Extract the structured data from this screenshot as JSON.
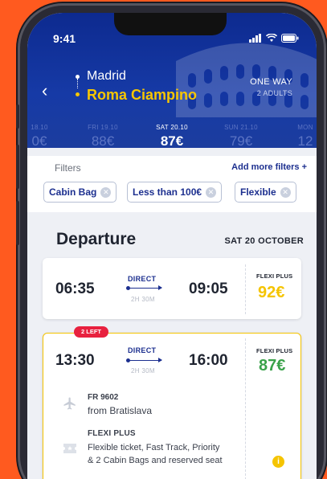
{
  "status_bar": {
    "time": "9:41"
  },
  "route": {
    "origin": "Madrid",
    "destination": "Roma Ciampino",
    "trip_type": "ONE WAY",
    "passengers": "2 ADULTS"
  },
  "dates": [
    {
      "label": "18.10",
      "price": "0€"
    },
    {
      "label": "FRI 19.10",
      "price": "88€"
    },
    {
      "label": "SAT 20.10",
      "price": "87€",
      "selected": true
    },
    {
      "label": "SUN 21.10",
      "price": "79€"
    },
    {
      "label": "MON",
      "price": "12"
    }
  ],
  "filters": {
    "label": "Filters",
    "add_more": "Add more filters +",
    "chips": [
      "Cabin Bag",
      "Less than 100€",
      "Flexible"
    ]
  },
  "departure": {
    "title": "Departure",
    "date": "SAT 20 OCTOBER"
  },
  "flights": [
    {
      "depart": "06:35",
      "arrive": "09:05",
      "type": "DIRECT",
      "duration": "2H 30M",
      "fare": "FLEXI PLUS",
      "price": "92€"
    },
    {
      "depart": "13:30",
      "arrive": "16:00",
      "type": "DIRECT",
      "duration": "2H 30M",
      "fare": "FLEXI PLUS",
      "price": "87€",
      "badge": "2 LEFT",
      "flight_number": "FR 9602",
      "from": "from Bratislava",
      "fare_title": "FLEXI PLUS",
      "fare_description_line1": "Flexible ticket, Fast Track, Priority",
      "fare_description_line2": "& 2 Cabin Bags and reserved seat"
    }
  ],
  "colors": {
    "brand_blue": "#163aa6",
    "accent_yellow": "#f5c400",
    "badge_red": "#e8213f",
    "background_orange": "#ff5a1f"
  }
}
